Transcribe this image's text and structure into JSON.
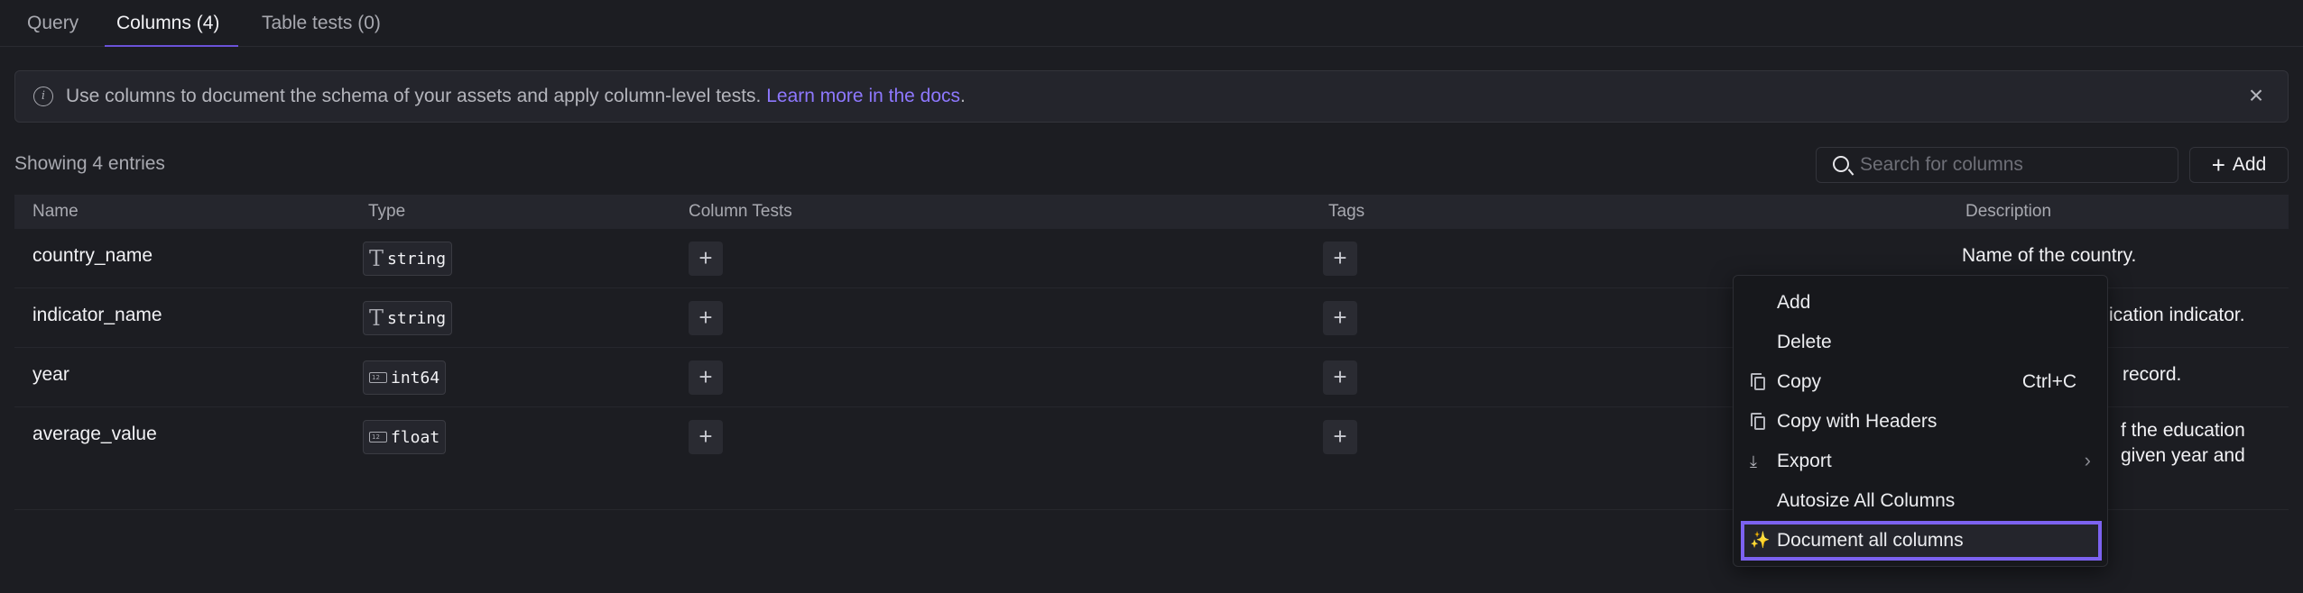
{
  "tabs": [
    {
      "label": "Query",
      "active": false
    },
    {
      "label": "Columns (4)",
      "active": true
    },
    {
      "label": "Table tests (0)",
      "active": false
    }
  ],
  "banner": {
    "text": "Use columns to document the schema of your assets and apply column-level tests. ",
    "link": "Learn more in the docs",
    "link_suffix": ".",
    "link_color": "#8e78ff"
  },
  "toolbar": {
    "showing": "Showing 4 entries",
    "search_placeholder": "Search for columns",
    "add_label": "Add"
  },
  "table": {
    "headers": [
      "Name",
      "Type",
      "Column Tests",
      "Tags",
      "Description"
    ],
    "rows": [
      {
        "name": "country_name",
        "type": "string",
        "type_icon": "text-type-icon",
        "description": "Name of the country."
      },
      {
        "name": "indicator_name",
        "type": "string",
        "type_icon": "text-type-icon",
        "description": "ication indicator."
      },
      {
        "name": "year",
        "type": "int64",
        "type_icon": "number-type-icon",
        "description": "record."
      },
      {
        "name": "average_value",
        "type": "float",
        "type_icon": "number-type-icon",
        "description_lines": [
          "f the education",
          "given year and"
        ]
      }
    ]
  },
  "context_menu": {
    "items": [
      {
        "label": "Add"
      },
      {
        "label": "Delete"
      },
      {
        "label": "Copy",
        "icon": "copy-icon",
        "shortcut": "Ctrl+C"
      },
      {
        "label": "Copy with Headers",
        "icon": "copy-icon"
      },
      {
        "label": "Export",
        "icon": "download-icon",
        "submenu": true
      },
      {
        "label": "Autosize All Columns"
      },
      {
        "label": "Document all columns",
        "icon": "magic-wand-icon",
        "highlighted": true
      }
    ],
    "highlight_color": "#7c62f0"
  }
}
